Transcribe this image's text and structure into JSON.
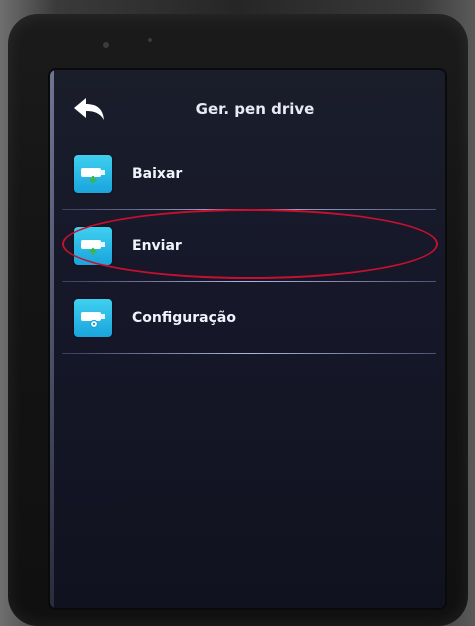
{
  "header": {
    "title": "Ger. pen drive",
    "back_icon": "back-arrow-icon"
  },
  "menu": {
    "items": [
      {
        "label": "Baixar",
        "icon": "usb-download-icon"
      },
      {
        "label": "Enviar",
        "icon": "usb-upload-icon"
      },
      {
        "label": "Configuração",
        "icon": "usb-settings-icon"
      }
    ]
  },
  "colors": {
    "screen_bg": "#16182a",
    "icon_tile": "#1aa4dd",
    "highlight_ellipse": "#c8102e",
    "text": "#f1f3fb"
  }
}
